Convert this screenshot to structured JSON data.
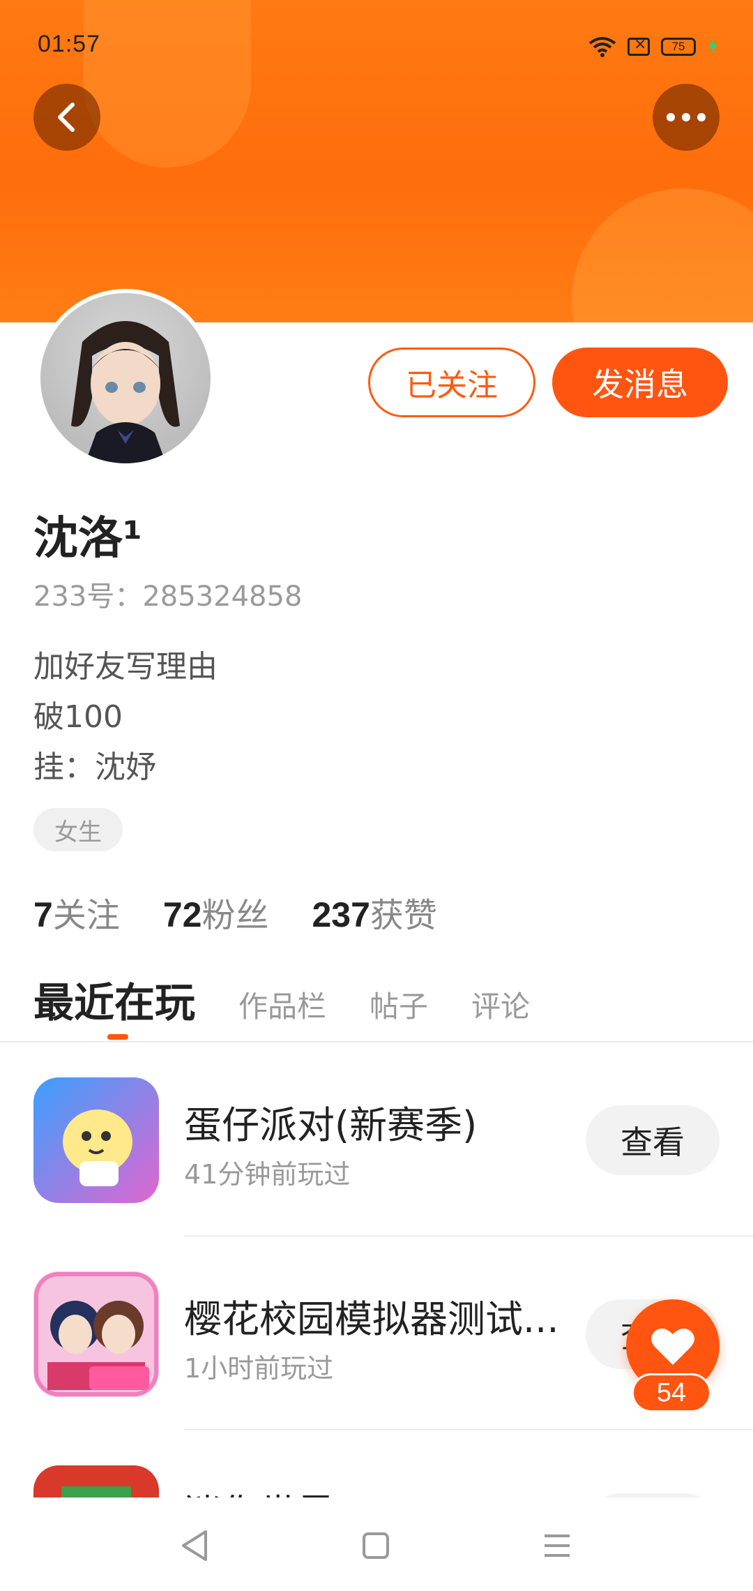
{
  "status_bar": {
    "time": "01:57",
    "battery": "75"
  },
  "colors": {
    "accent": "#ff5510",
    "banner": "#ff7a12"
  },
  "header": {
    "back_icon": "chevron-left-icon",
    "more_icon": "more-horizontal-icon"
  },
  "profile": {
    "name": "沈洛¹",
    "account_id": "233号：285324858",
    "bio": [
      "加好友写理由",
      "破100",
      "挂：沈妤"
    ],
    "tag": "女生",
    "follow_label": "已关注",
    "message_label": "发消息"
  },
  "stats": [
    {
      "num": "7",
      "label": "关注"
    },
    {
      "num": "72",
      "label": "粉丝"
    },
    {
      "num": "237",
      "label": "获赞"
    }
  ],
  "tabs": [
    "最近在玩",
    "作品栏",
    "帖子",
    "评论"
  ],
  "games": [
    {
      "title": "蛋仔派对(新赛季)",
      "subtitle": "41分钟前玩过",
      "button": "查看"
    },
    {
      "title": "樱花校园模拟器测试...",
      "subtitle": "1小时前玩过",
      "button": "查看"
    },
    {
      "title": "迷你世界",
      "subtitle": "",
      "button": "查看"
    }
  ],
  "like": {
    "icon": "heart-icon",
    "count": "54"
  },
  "nav": [
    "back-triangle-icon",
    "home-square-icon",
    "menu-lines-icon"
  ]
}
